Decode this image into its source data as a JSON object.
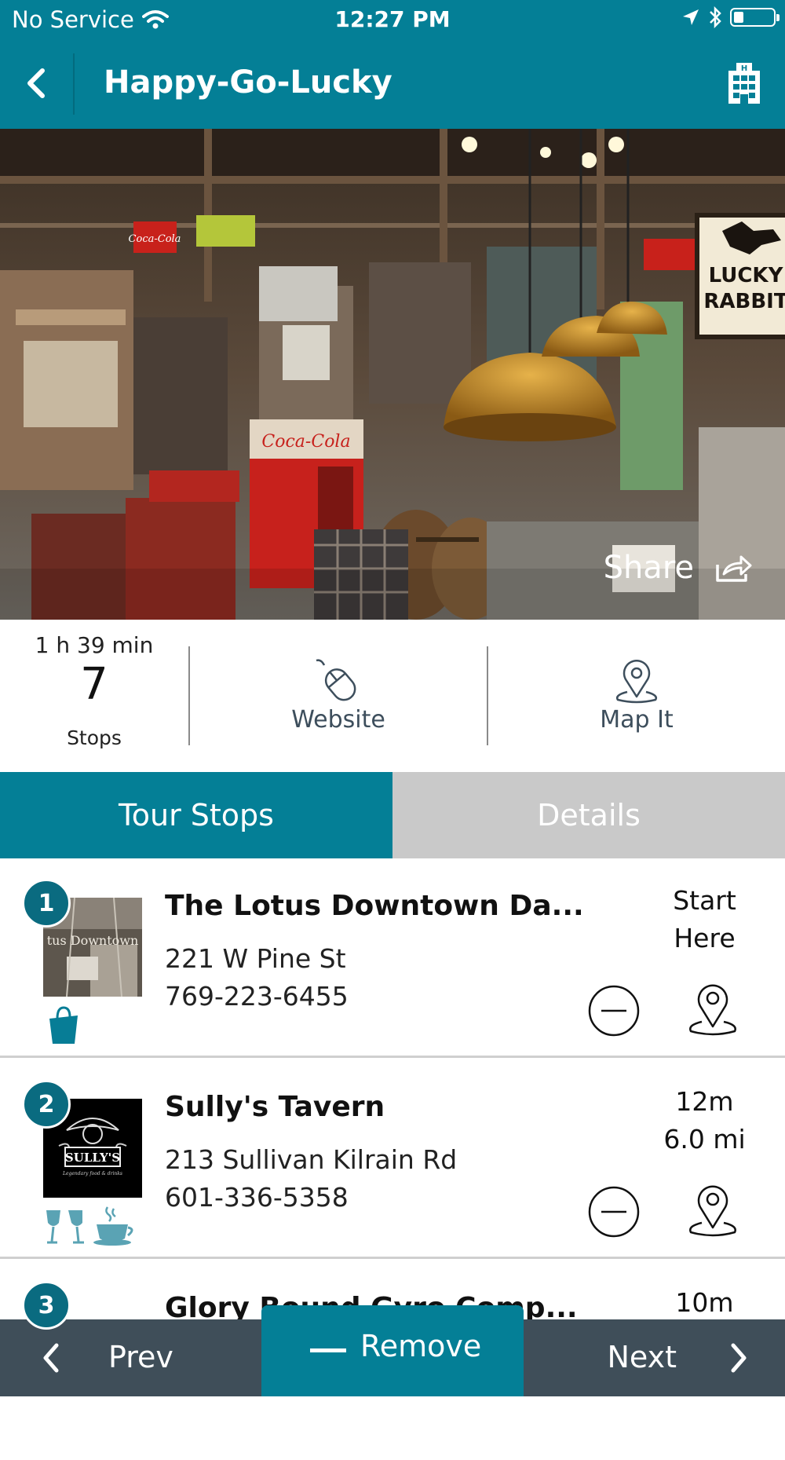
{
  "status_bar": {
    "carrier": "No Service",
    "time": "12:27 PM"
  },
  "nav": {
    "title": "Happy-Go-Lucky",
    "back_icon": "chevron-left-icon",
    "right_icon": "building-icon"
  },
  "hero": {
    "share_label": "Share",
    "share_icon": "share-icon",
    "signs": [
      "Coca-Cola",
      "LUCKY",
      "RABBIT"
    ]
  },
  "stats": {
    "duration": "1 h 39 min",
    "stop_count": "7",
    "stops_label": "Stops",
    "website_label": "Website",
    "map_it_label": "Map It"
  },
  "tabs": {
    "tour_stops": "Tour Stops",
    "details": "Details"
  },
  "stops": [
    {
      "number": "1",
      "name": "The Lotus Downtown Da...",
      "address": "221 W Pine St",
      "phone": "769-223-6455",
      "meta_line1": "Start",
      "meta_line2": "Here",
      "thumb_text": "tus Downtown",
      "category_icons": [
        "shopping-bag-icon"
      ]
    },
    {
      "number": "2",
      "name": "Sully's Tavern",
      "address": "213 Sullivan Kilrain Rd",
      "phone": "601-336-5358",
      "meta_line1": "12m",
      "meta_line2": "6.0 mi",
      "thumb_text": "SULLY'S",
      "thumb_subtext": "Legendary food & drinks",
      "category_icons": [
        "wine-glasses-icon",
        "coffee-cup-icon"
      ]
    },
    {
      "number": "3",
      "name": "Glory Bound Gyro Comp...",
      "meta_line1": "10m"
    }
  ],
  "bottom_bar": {
    "prev_label": "Prev",
    "next_label": "Next",
    "remove_label": "Remove"
  },
  "colors": {
    "brand_teal": "#047f96",
    "badge_teal": "#0a6b80",
    "bottom_bar": "#3f4e59",
    "inactive_tab": "#c9c9c9",
    "category_icon": "#5aa3b4"
  }
}
